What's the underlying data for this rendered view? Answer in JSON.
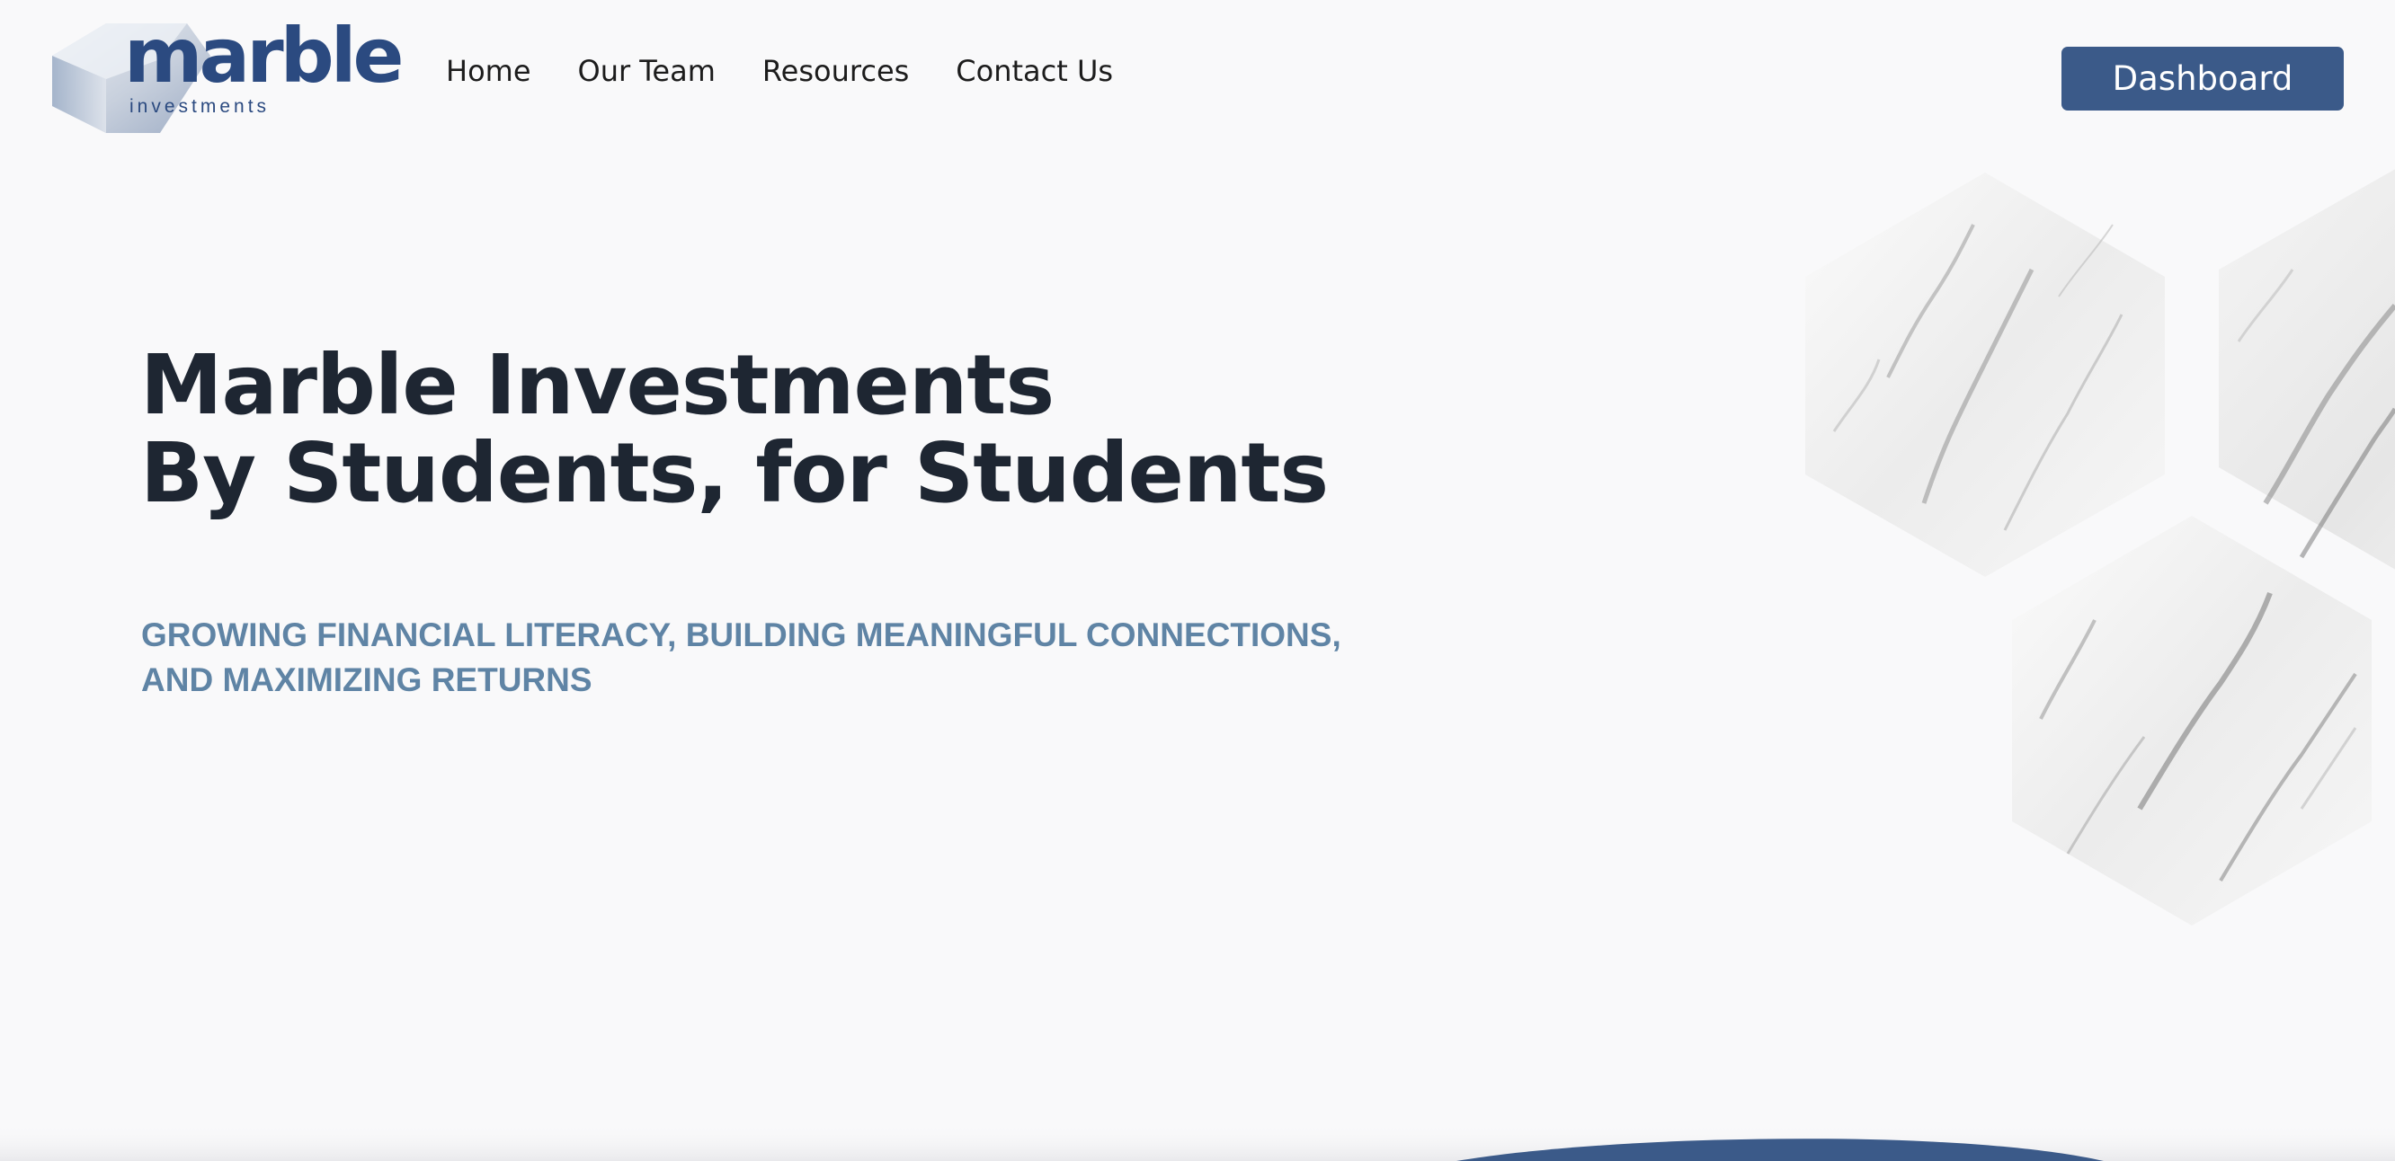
{
  "brand": {
    "wordmark": "marble",
    "subline": "investments",
    "primary_color": "#2b4a80",
    "button_color": "#3b5a89",
    "tagline_color": "#5f84a5",
    "heading_color": "#1e2632"
  },
  "nav": {
    "items": [
      {
        "label": "Home"
      },
      {
        "label": "Our Team"
      },
      {
        "label": "Resources"
      },
      {
        "label": "Contact Us"
      }
    ],
    "dashboard_label": "Dashboard"
  },
  "hero": {
    "title_line1": "Marble Investments",
    "title_line2": "By Students, for Students",
    "tagline": "GROWING FINANCIAL LITERACY, BUILDING MEANINGFUL CONNECTIONS, AND MAXIMIZING RETURNS"
  },
  "decor": {
    "image": "marble-hexagon-tiles",
    "logo_icon": "hexagon-logo-icon"
  }
}
